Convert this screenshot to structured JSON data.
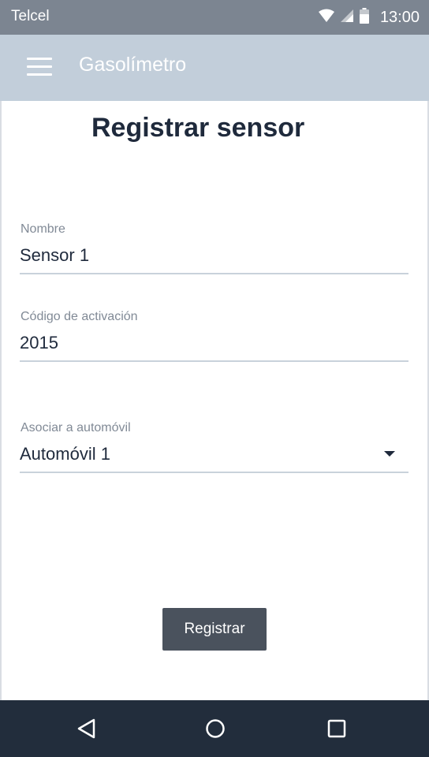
{
  "status_bar": {
    "carrier": "Telcel",
    "time": "13:00",
    "icons": [
      "wifi-icon",
      "signal-icon",
      "battery-icon"
    ]
  },
  "app_bar": {
    "menu_icon": "menu-icon",
    "title": "Gasolímetro"
  },
  "page": {
    "title": "Registrar sensor"
  },
  "form": {
    "name": {
      "label": "Nombre",
      "value": "Sensor 1"
    },
    "activation_code": {
      "label": "Código de activación",
      "value": "2015"
    },
    "vehicle": {
      "label": "Asociar a automóvil",
      "value": "Automóvil 1",
      "icon": "dropdown-arrow-icon"
    },
    "submit_label": "Registrar"
  },
  "nav_bar": {
    "buttons": [
      "back-icon",
      "home-icon",
      "recents-icon"
    ]
  },
  "colors": {
    "status_bar": "#7c8591",
    "app_bar": "#c2ceda",
    "title_text": "#1f2a3c",
    "label_text": "#818a96",
    "button": "#4a525d",
    "nav_bar": "#222d3c"
  }
}
